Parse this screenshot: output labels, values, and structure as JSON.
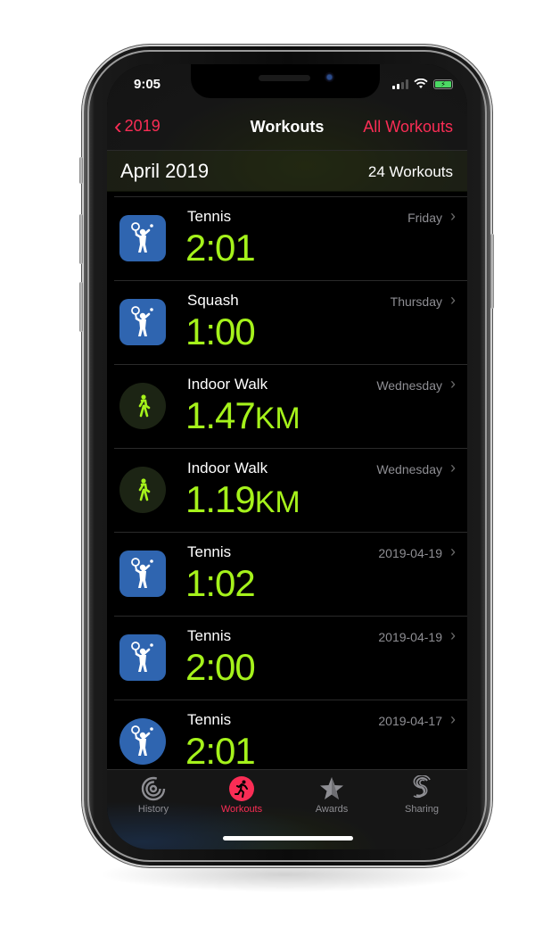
{
  "status_bar": {
    "time": "9:05",
    "battery_glyph": "⚡"
  },
  "nav": {
    "back_label": "2019",
    "title": "Workouts",
    "right_label": "All Workouts"
  },
  "section": {
    "title": "April 2019",
    "count": "24 Workouts"
  },
  "workouts": [
    {
      "name": "Tennis",
      "value": "2:01",
      "unit": "",
      "date": "Friday",
      "icon": "tennis-icon",
      "icon_shape": "rounded"
    },
    {
      "name": "Squash",
      "value": "1:00",
      "unit": "",
      "date": "Thursday",
      "icon": "tennis-icon",
      "icon_shape": "rounded"
    },
    {
      "name": "Indoor Walk",
      "value": "1.47",
      "unit": "KM",
      "date": "Wednesday",
      "icon": "walk-icon",
      "icon_shape": "circle"
    },
    {
      "name": "Indoor Walk",
      "value": "1.19",
      "unit": "KM",
      "date": "Wednesday",
      "icon": "walk-icon",
      "icon_shape": "circle"
    },
    {
      "name": "Tennis",
      "value": "1:02",
      "unit": "",
      "date": "2019-04-19",
      "icon": "tennis-icon",
      "icon_shape": "rounded"
    },
    {
      "name": "Tennis",
      "value": "2:00",
      "unit": "",
      "date": "2019-04-19",
      "icon": "tennis-icon",
      "icon_shape": "rounded"
    },
    {
      "name": "Tennis",
      "value": "2:01",
      "unit": "",
      "date": "2019-04-17",
      "icon": "tennis-icon",
      "icon_shape": "circle"
    }
  ],
  "chevron": "›",
  "tabs": [
    {
      "label": "History",
      "icon": "history-rings-icon",
      "active": false
    },
    {
      "label": "Workouts",
      "icon": "running-figure-icon",
      "active": true
    },
    {
      "label": "Awards",
      "icon": "star-award-icon",
      "active": false
    },
    {
      "label": "Sharing",
      "icon": "sharing-icon",
      "active": false
    }
  ],
  "colors": {
    "accent": "#fa2d55",
    "metric": "#a5f21b",
    "tennis_icon_bg": "#2f65b0",
    "secondary_text": "#8e8e93"
  }
}
